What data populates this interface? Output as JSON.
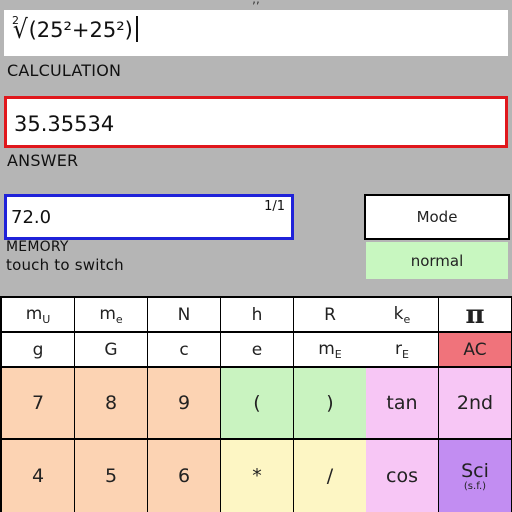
{
  "calculation": {
    "label": "CALCULATION",
    "root_index": "2",
    "root_sign": "√",
    "expression": "(25²+25²)"
  },
  "answer": {
    "label": "ANSWER",
    "value": "35.35534"
  },
  "memory": {
    "value": "72.0",
    "index": "1/1",
    "label": "MEMORY",
    "hint": "touch to switch"
  },
  "mode": {
    "button_label": "Mode",
    "value": "normal"
  },
  "keys": {
    "row1": [
      {
        "main": "m",
        "sub": "U"
      },
      {
        "main": "m",
        "sub": "e"
      },
      {
        "main": "N",
        "sub": ""
      },
      {
        "main": "h",
        "sub": ""
      },
      {
        "main": "R",
        "sub": ""
      },
      {
        "main": "k",
        "sub": "e"
      },
      {
        "main": "π",
        "sub": ""
      }
    ],
    "row2": [
      {
        "main": "g",
        "sub": ""
      },
      {
        "main": "G",
        "sub": ""
      },
      {
        "main": "c",
        "sub": ""
      },
      {
        "main": "e",
        "sub": ""
      },
      {
        "main": "m",
        "sub": "E"
      },
      {
        "main": "r",
        "sub": "E"
      },
      {
        "main": "AC",
        "sub": ""
      }
    ],
    "row3": [
      "7",
      "8",
      "9",
      "(",
      ")",
      "tan",
      "2nd"
    ],
    "row4": [
      "4",
      "5",
      "6",
      "*",
      "/",
      "cos",
      "Sci"
    ],
    "sci_sub": "(s.f.)"
  },
  "colors": {
    "panel": "#b5b5b5",
    "answer_border": "#e0171c",
    "memory_border": "#1f22d9",
    "normal_bg": "#c8f7c0",
    "numeric_key": "#fcd3b3",
    "op_green": "#c9f3c0",
    "op_yellow": "#fdf6c4",
    "fn_pink": "#f7c6f5",
    "ac_red": "#f0737b",
    "sci_purple": "#c28df2"
  }
}
